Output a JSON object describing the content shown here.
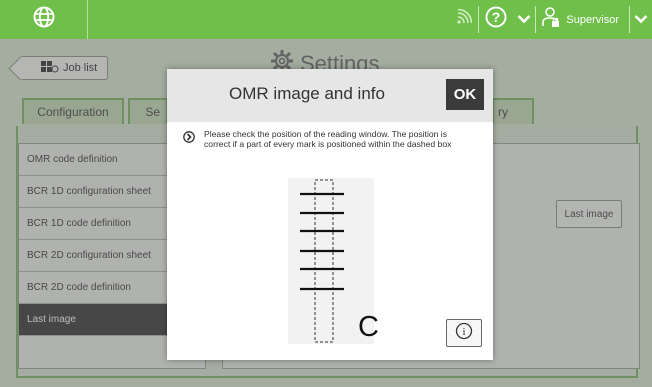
{
  "header": {
    "user_label": "Supervisor",
    "icons": [
      "globe-icon",
      "wifi-signal-icon",
      "help-icon",
      "chevron-down-icon",
      "user-icon",
      "chevron-down-icon"
    ]
  },
  "page": {
    "back_label": "Job list",
    "title": "Settings",
    "tabs": [
      {
        "label": "Configuration"
      },
      {
        "label": "Se"
      },
      {
        "label": "ry"
      }
    ],
    "list_items": [
      {
        "label": "OMR code definition"
      },
      {
        "label": "BCR 1D configuration sheet"
      },
      {
        "label": "BCR 1D code definition"
      },
      {
        "label": "BCR 2D configuration sheet"
      },
      {
        "label": "BCR 2D code definition"
      },
      {
        "label": "Last image"
      }
    ],
    "last_image_button": "Last image"
  },
  "modal": {
    "title": "OMR image and info",
    "ok_label": "OK",
    "info_text": "Please check the position of the reading window. The position is correct if a part of every mark is positioned within the dashed box",
    "omr_letter": "C"
  },
  "colors": {
    "topbar": "#6fbf4a",
    "accent_border": "#7fb866",
    "selected_item": "#3a3a3a",
    "ok_button": "#3b3b3b"
  }
}
